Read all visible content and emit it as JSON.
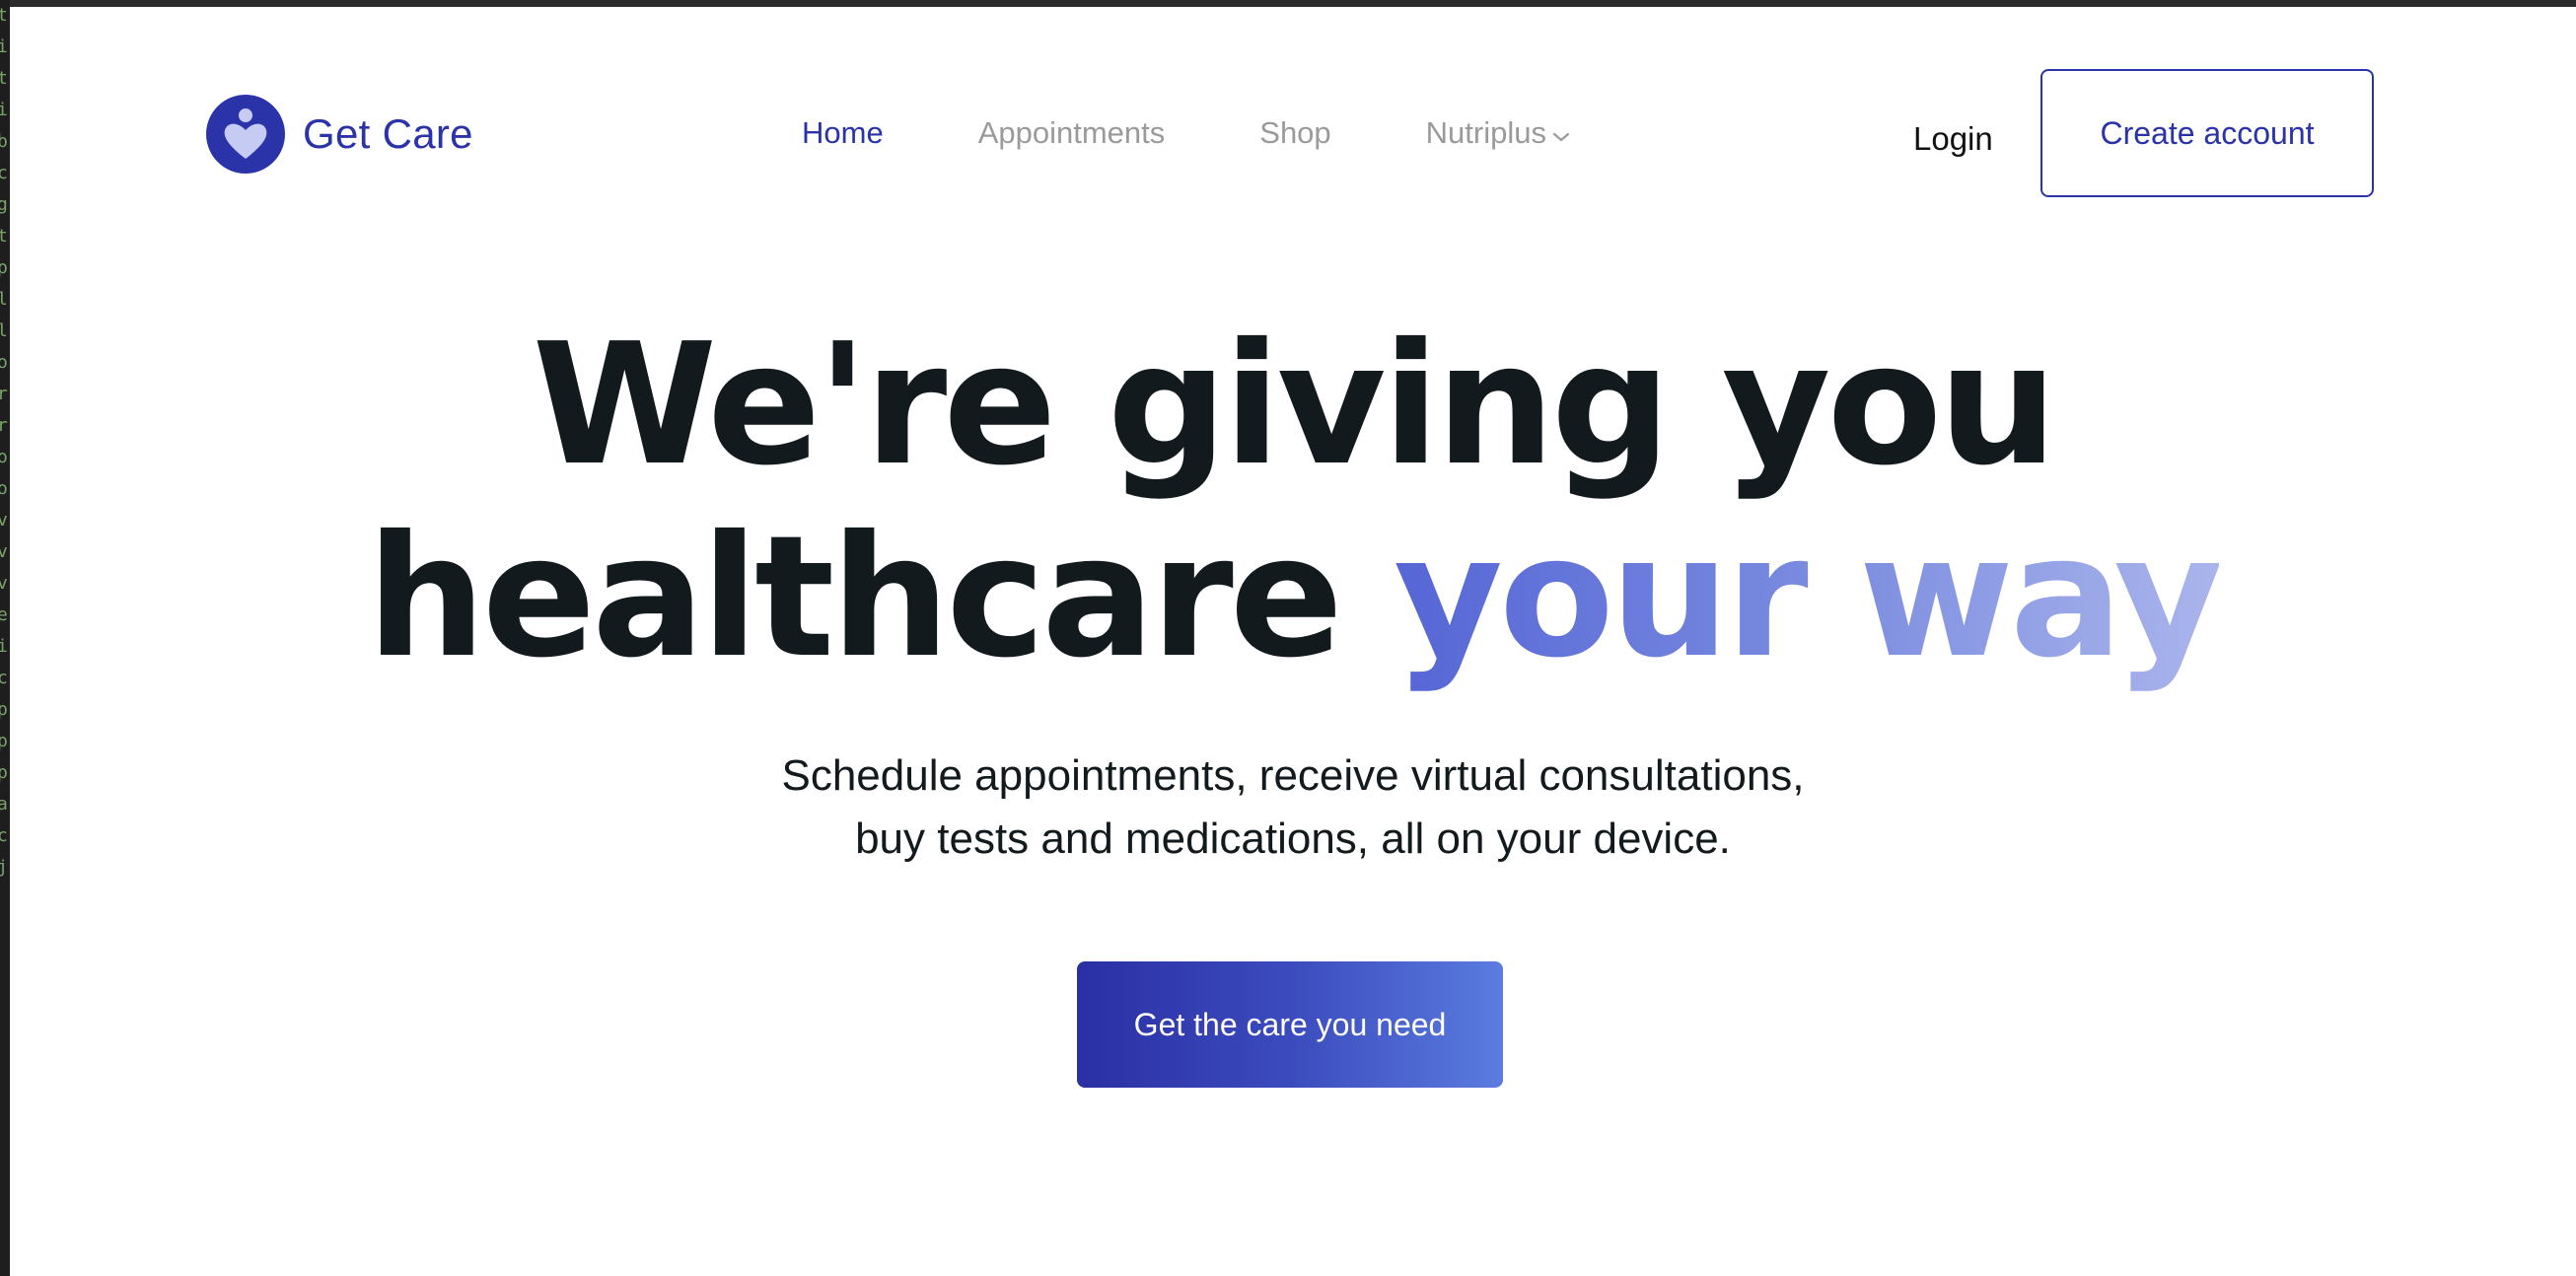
{
  "brand": {
    "name": "Get Care",
    "logo_icon": "heart-person-icon",
    "color": "#2b33a8"
  },
  "nav": {
    "items": [
      {
        "label": "Home",
        "active": true
      },
      {
        "label": "Appointments",
        "active": false
      },
      {
        "label": "Shop",
        "active": false
      },
      {
        "label": "Nutriplus",
        "active": false,
        "icon": "chevron-down-icon"
      }
    ]
  },
  "auth": {
    "login_label": "Login",
    "create_account_label": "Create account"
  },
  "hero": {
    "headline_line1": "We're giving you",
    "headline_line2_plain": "healthcare ",
    "headline_line2_accent": "your way",
    "subtitle_line1": "Schedule appointments, receive virtual consultations,",
    "subtitle_line2": "buy tests and medications, all on your device.",
    "cta_label": "Get the care you need"
  },
  "colors": {
    "headline": "#131a1e",
    "accent_gradient_start": "#5566d6",
    "accent_gradient_end": "#aab5ec",
    "cta_gradient_start": "#2a2fa4",
    "cta_gradient_end": "#5b7ce0",
    "nav_inactive": "#9a9a9a"
  },
  "editor_gutter": {
    "glyphs": [
      "t",
      "i",
      "t",
      "i",
      "b",
      "c",
      "g",
      "t",
      "p",
      "l",
      "l",
      "o",
      "r",
      "r",
      "o",
      "o",
      "v",
      "v",
      "v",
      "e",
      "i",
      "c",
      "p",
      "p",
      "p",
      "a",
      "c",
      "",
      "j"
    ]
  }
}
